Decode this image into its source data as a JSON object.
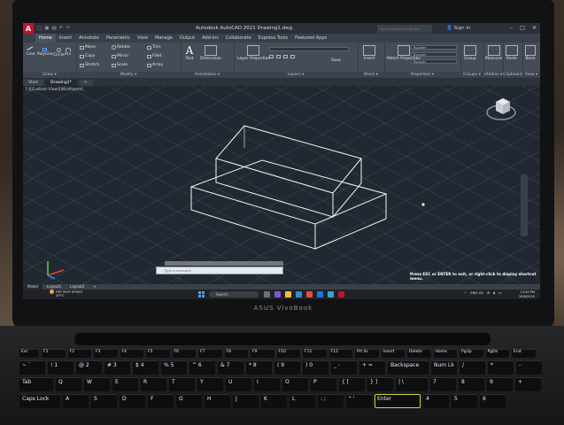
{
  "app": {
    "logo_letter": "A",
    "title": "Autodesk AutoCAD 2021   Drawing1.dwg",
    "search_placeholder": "Type a keyword or phrase",
    "signin_label": "Sign In"
  },
  "ribbon_tabs": [
    "Home",
    "Insert",
    "Annotate",
    "Parametric",
    "View",
    "Manage",
    "Output",
    "Add-ins",
    "Collaborate",
    "Express Tools",
    "Featured Apps"
  ],
  "ribbon": {
    "draw": {
      "label": "Draw ▾",
      "line": "Line",
      "polyline": "Polyline",
      "circle": "Circle",
      "arc": "Arc"
    },
    "modify": {
      "label": "Modify ▾",
      "move": "Move",
      "rotate": "Rotate",
      "trim": "Trim",
      "copy": "Copy",
      "mirror": "Mirror",
      "fillet": "Fillet",
      "stretch": "Stretch",
      "scale": "Scale",
      "array": "Array"
    },
    "annotation": {
      "label": "Annotation ▾",
      "text": "Text",
      "dimension": "Dimension"
    },
    "layers": {
      "label": "Layers ▾",
      "properties": "Layer Properties",
      "save": "Save"
    },
    "block": {
      "label": "Block ▾",
      "insert": "Insert"
    },
    "properties": {
      "label": "Properties ▾",
      "match": "Match Properties",
      "bylayer1": "ByLayer",
      "bylayer2": "ByLayer",
      "bylayer3": "ByLayer"
    },
    "groups": {
      "label": "Groups ▾",
      "group": "Group"
    },
    "utilities": {
      "label": "Utilities ▾",
      "measure": "Measure"
    },
    "clipboard": {
      "label": "Clipboard",
      "paste": "Paste"
    },
    "view": {
      "label": "View ▾",
      "base": "Base"
    }
  },
  "file_tabs": [
    "Start",
    "Drawing1*",
    "+"
  ],
  "viewport": {
    "label": "[-][Custom View][Wireframe]",
    "cmd_placeholder": "Type a command",
    "notice": "Press ESC or ENTER to exit, or right-click to display shortcut menu."
  },
  "layout_tabs": [
    "Model",
    "Layout1",
    "Layout2",
    "+"
  ],
  "taskbar": {
    "weather_title": "Hot days ahead",
    "weather_temp": "29°C",
    "search_label": "Search",
    "tray_lang": "ENG\nUS",
    "time": "12:40 PM",
    "date": "26/8/2020"
  },
  "laptop": {
    "brand": "ASUS VivoBook"
  },
  "keyboard": {
    "fn_row": [
      "Esc",
      "F1",
      "F2",
      "F3",
      "F4",
      "F5",
      "F6",
      "F7",
      "F8",
      "F9",
      "F10",
      "F11",
      "F12",
      "Prt Sc",
      "Insert",
      "Delete",
      "Home",
      "PgUp",
      "PgDn",
      "End"
    ],
    "num_row": [
      "~ `",
      "! 1",
      "@ 2",
      "# 3",
      "$ 4",
      "% 5",
      "^ 6",
      "& 7",
      "* 8",
      "( 9",
      ") 0",
      "_ -",
      "+ =",
      "Backspace",
      "Num Lk",
      "/",
      "*",
      "-"
    ],
    "q_row": [
      "Tab",
      "Q",
      "W",
      "E",
      "R",
      "T",
      "Y",
      "U",
      "I",
      "O",
      "P",
      "{ [",
      "} ]",
      "| \\",
      "7",
      "8",
      "9",
      "+"
    ],
    "a_row": [
      "Caps Lock",
      "A",
      "S",
      "D",
      "F",
      "G",
      "H",
      "J",
      "K",
      "L",
      ": ;",
      "\" '",
      "Enter",
      "4",
      "5",
      "6"
    ]
  },
  "colors": {
    "autocad_red": "#c8102e",
    "viewport_bg": "#222831",
    "ribbon_bg": "#454c57",
    "wireframe": "#f2f4f7"
  }
}
